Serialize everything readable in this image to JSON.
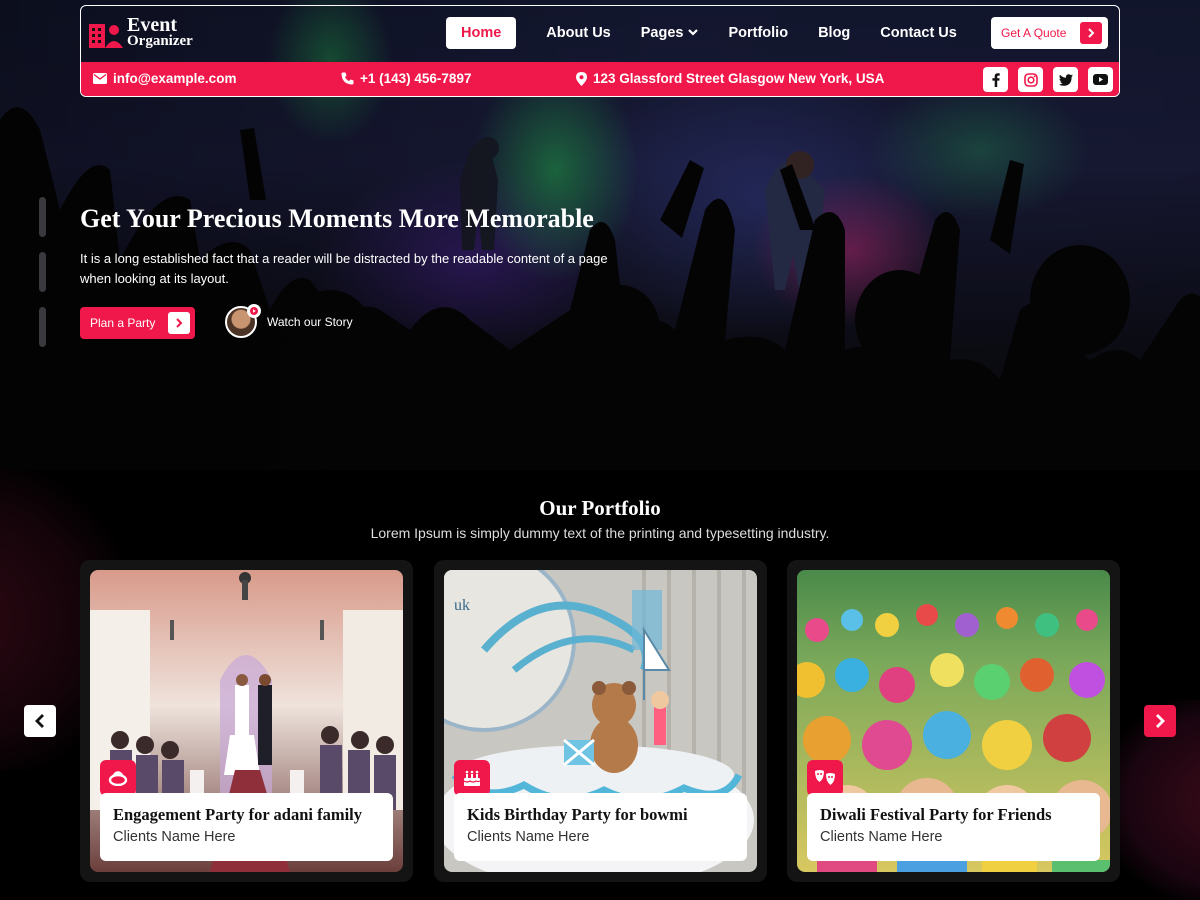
{
  "logo": {
    "line1": "Event",
    "line2": "Organizer"
  },
  "nav": {
    "items": [
      {
        "label": "Home",
        "active": true
      },
      {
        "label": "About Us"
      },
      {
        "label": "Pages",
        "has_dropdown": true
      },
      {
        "label": "Portfolio"
      },
      {
        "label": "Blog"
      },
      {
        "label": "Contact Us"
      }
    ],
    "quote_button": "Get A Quote"
  },
  "contact": {
    "email": "info@example.com",
    "phone": "+1 (143) 456-7897",
    "address": "123 Glassford Street Glasgow New York, USA"
  },
  "socials": [
    "facebook-icon",
    "instagram-icon",
    "twitter-icon",
    "youtube-icon"
  ],
  "hero": {
    "title": "Get Your Precious Moments More Memorable",
    "text": "It is a long established fact that a reader will be distracted by the readable content of a page when looking at its layout.",
    "primary_button": "Plan a Party",
    "watch_label": "Watch our Story"
  },
  "portfolio": {
    "title": "Our Portfolio",
    "subtitle": "Lorem Ipsum is simply dummy text of the printing and typesetting industry.",
    "cards": [
      {
        "title": "Engagement Party for adani family",
        "client": "Clients Name Here",
        "icon": "ring-icon"
      },
      {
        "title": "Kids Birthday Party for bowmi",
        "client": "Clients Name Here",
        "icon": "cake-icon"
      },
      {
        "title": "Diwali Festival Party for Friends",
        "client": "Clients Name Here",
        "icon": "masks-icon"
      }
    ]
  },
  "colors": {
    "accent": "#f0184a",
    "dark": "#000000",
    "card_bg": "#141414"
  }
}
